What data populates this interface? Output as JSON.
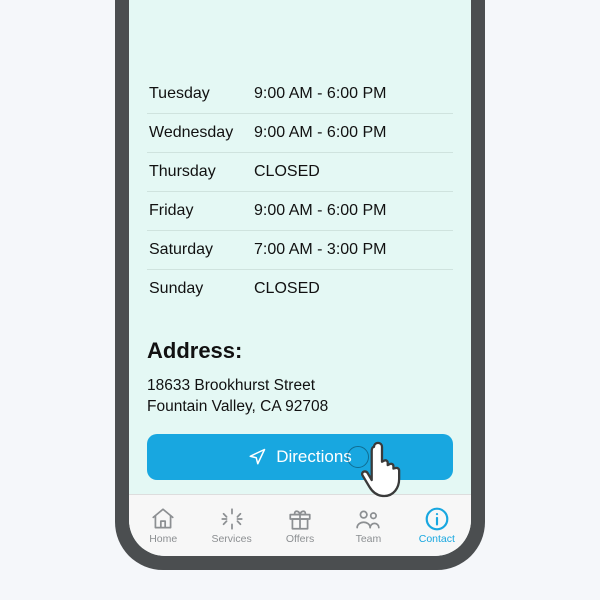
{
  "hours": [
    {
      "day": "Tuesday",
      "value": "9:00 AM - 6:00 PM"
    },
    {
      "day": "Wednesday",
      "value": "9:00 AM - 6:00 PM"
    },
    {
      "day": "Thursday",
      "value": "CLOSED"
    },
    {
      "day": "Friday",
      "value": "9:00 AM - 6:00 PM"
    },
    {
      "day": "Saturday",
      "value": "7:00 AM - 3:00 PM"
    },
    {
      "day": "Sunday",
      "value": "CLOSED"
    }
  ],
  "address": {
    "title": "Address:",
    "line1": "18633 Brookhurst Street",
    "line2": "Fountain Valley, CA 92708"
  },
  "directions_label": "Directions",
  "tabs": {
    "home": "Home",
    "services": "Services",
    "offers": "Offers",
    "team": "Team",
    "contact": "Contact"
  },
  "colors": {
    "accent": "#18a7e0"
  }
}
